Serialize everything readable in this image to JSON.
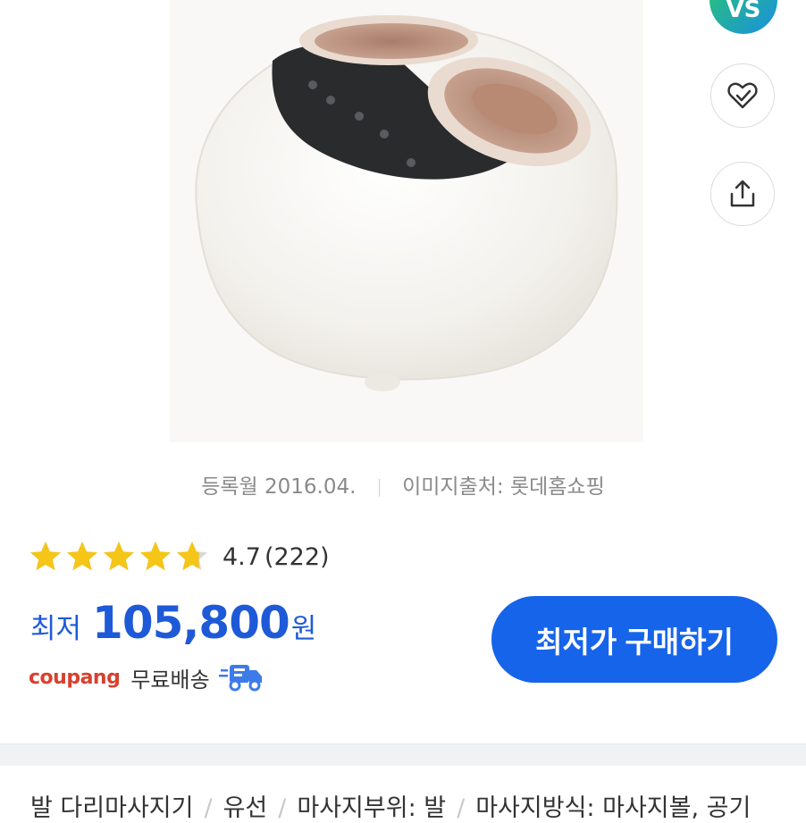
{
  "badge": {
    "text": "VS"
  },
  "meta": {
    "registered": "등록월 2016.04.",
    "image_source": "이미지출처: 롯데홈쇼핑"
  },
  "rating": {
    "stars": 4.7,
    "score": "4.7",
    "count": "(222)"
  },
  "price": {
    "label": "최저",
    "value": "105,800",
    "unit": "원"
  },
  "shipping": {
    "store": "coupang",
    "text": "무료배송"
  },
  "buy_button": {
    "label": "최저가 구매하기"
  },
  "specs": [
    "발 다리마사지기",
    "유선",
    "마사지부위: 발",
    "마사지방식: 마사지볼, 공기"
  ],
  "icons": {
    "wishlist": "heart-check-icon",
    "share": "share-icon",
    "delivery": "fast-delivery-truck-icon"
  },
  "colors": {
    "accent": "#1664ea",
    "price": "#1e5ad8",
    "star": "#f5c518",
    "coupang": "#d8402f"
  }
}
